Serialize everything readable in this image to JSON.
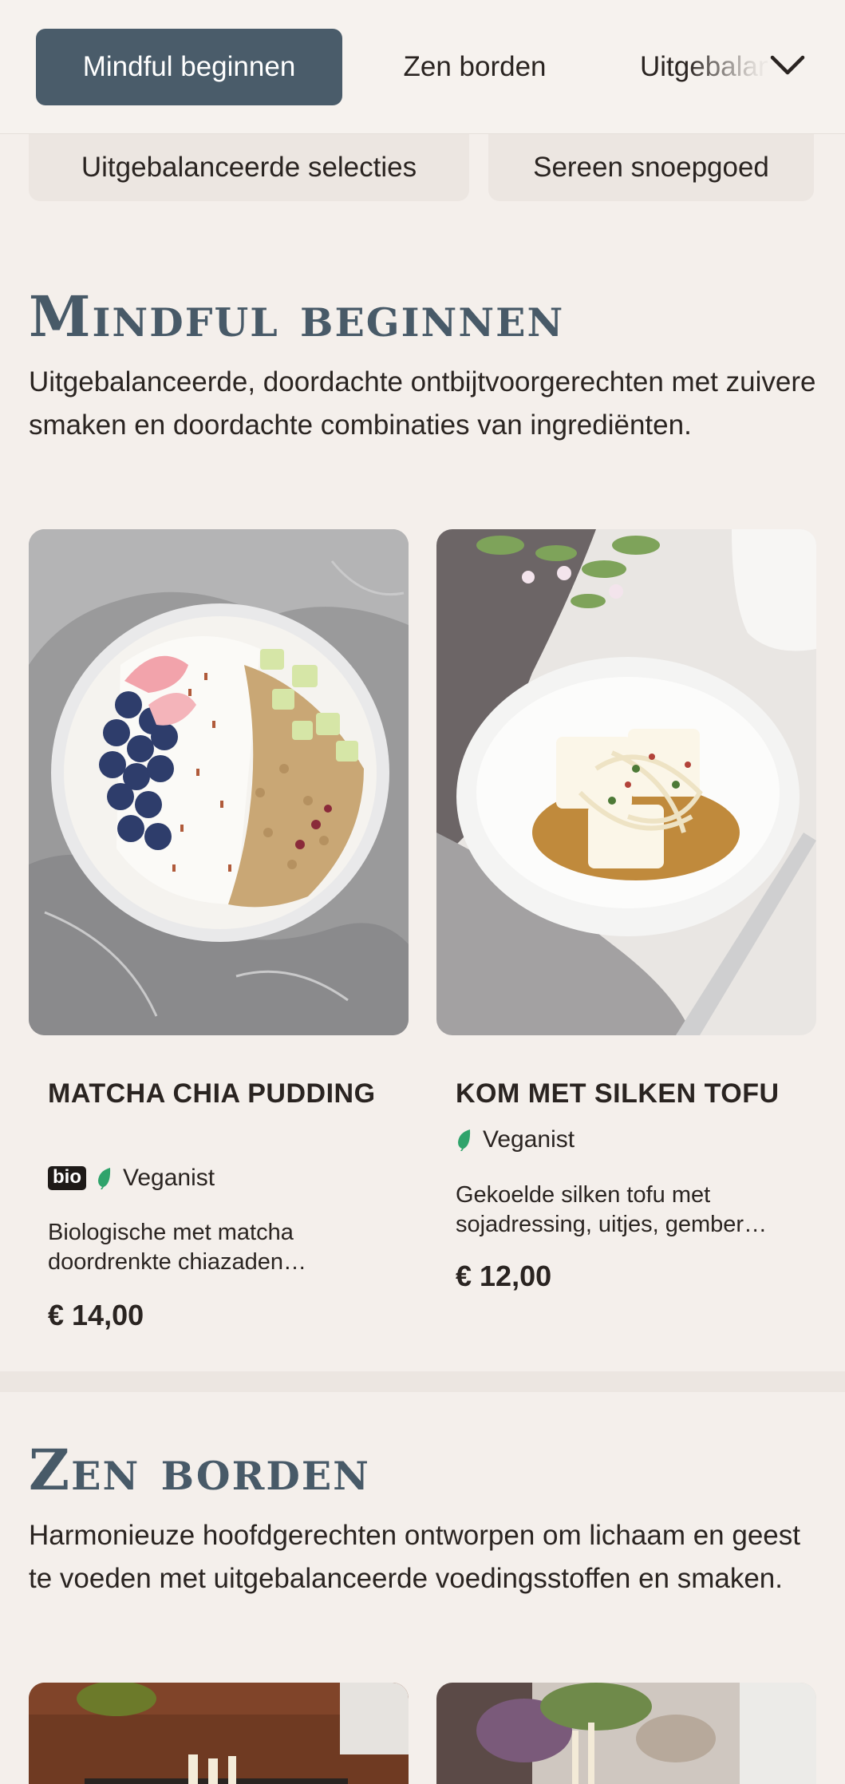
{
  "nav": {
    "tabs": [
      {
        "label": "Mindful beginnen",
        "active": true
      },
      {
        "label": "Zen borden",
        "active": false
      },
      {
        "label": "Uitgebalanceerde selecties",
        "active": false
      }
    ],
    "more_icon": "chevron-down-icon"
  },
  "subnav": {
    "pills": [
      {
        "label": "Uitgebalanceerde selecties"
      },
      {
        "label": "Sereen snoepgoed"
      }
    ]
  },
  "sections": [
    {
      "title": "Mindful beginnen",
      "description": "Uitgebalanceerde, doordachte ontbijtvoorgerechten met zuivere smaken en doordachte combinaties van ingrediënten.",
      "dishes": [
        {
          "name": "Matcha Chia Pudding",
          "badge": "bio",
          "diet": "Veganist",
          "description": "Biologische met matcha doordrenkte chiazaden…",
          "price": "€ 14,00"
        },
        {
          "name": "Kom met Silken Tofu",
          "diet": "Veganist",
          "description": "Gekoelde silken tofu met sojadressing, uitjes, gember…",
          "price": "€ 12,00"
        }
      ]
    },
    {
      "title": "Zen borden",
      "description": "Harmonieuze hoofdgerechten ontworpen om lichaam en geest te voeden met uitgebalanceerde voedingsstoffen en smaken."
    }
  ],
  "colors": {
    "background": "#f4efeb",
    "accent": "#4a5c6a",
    "title": "#485a68",
    "vegan_leaf": "#2fa36b"
  }
}
